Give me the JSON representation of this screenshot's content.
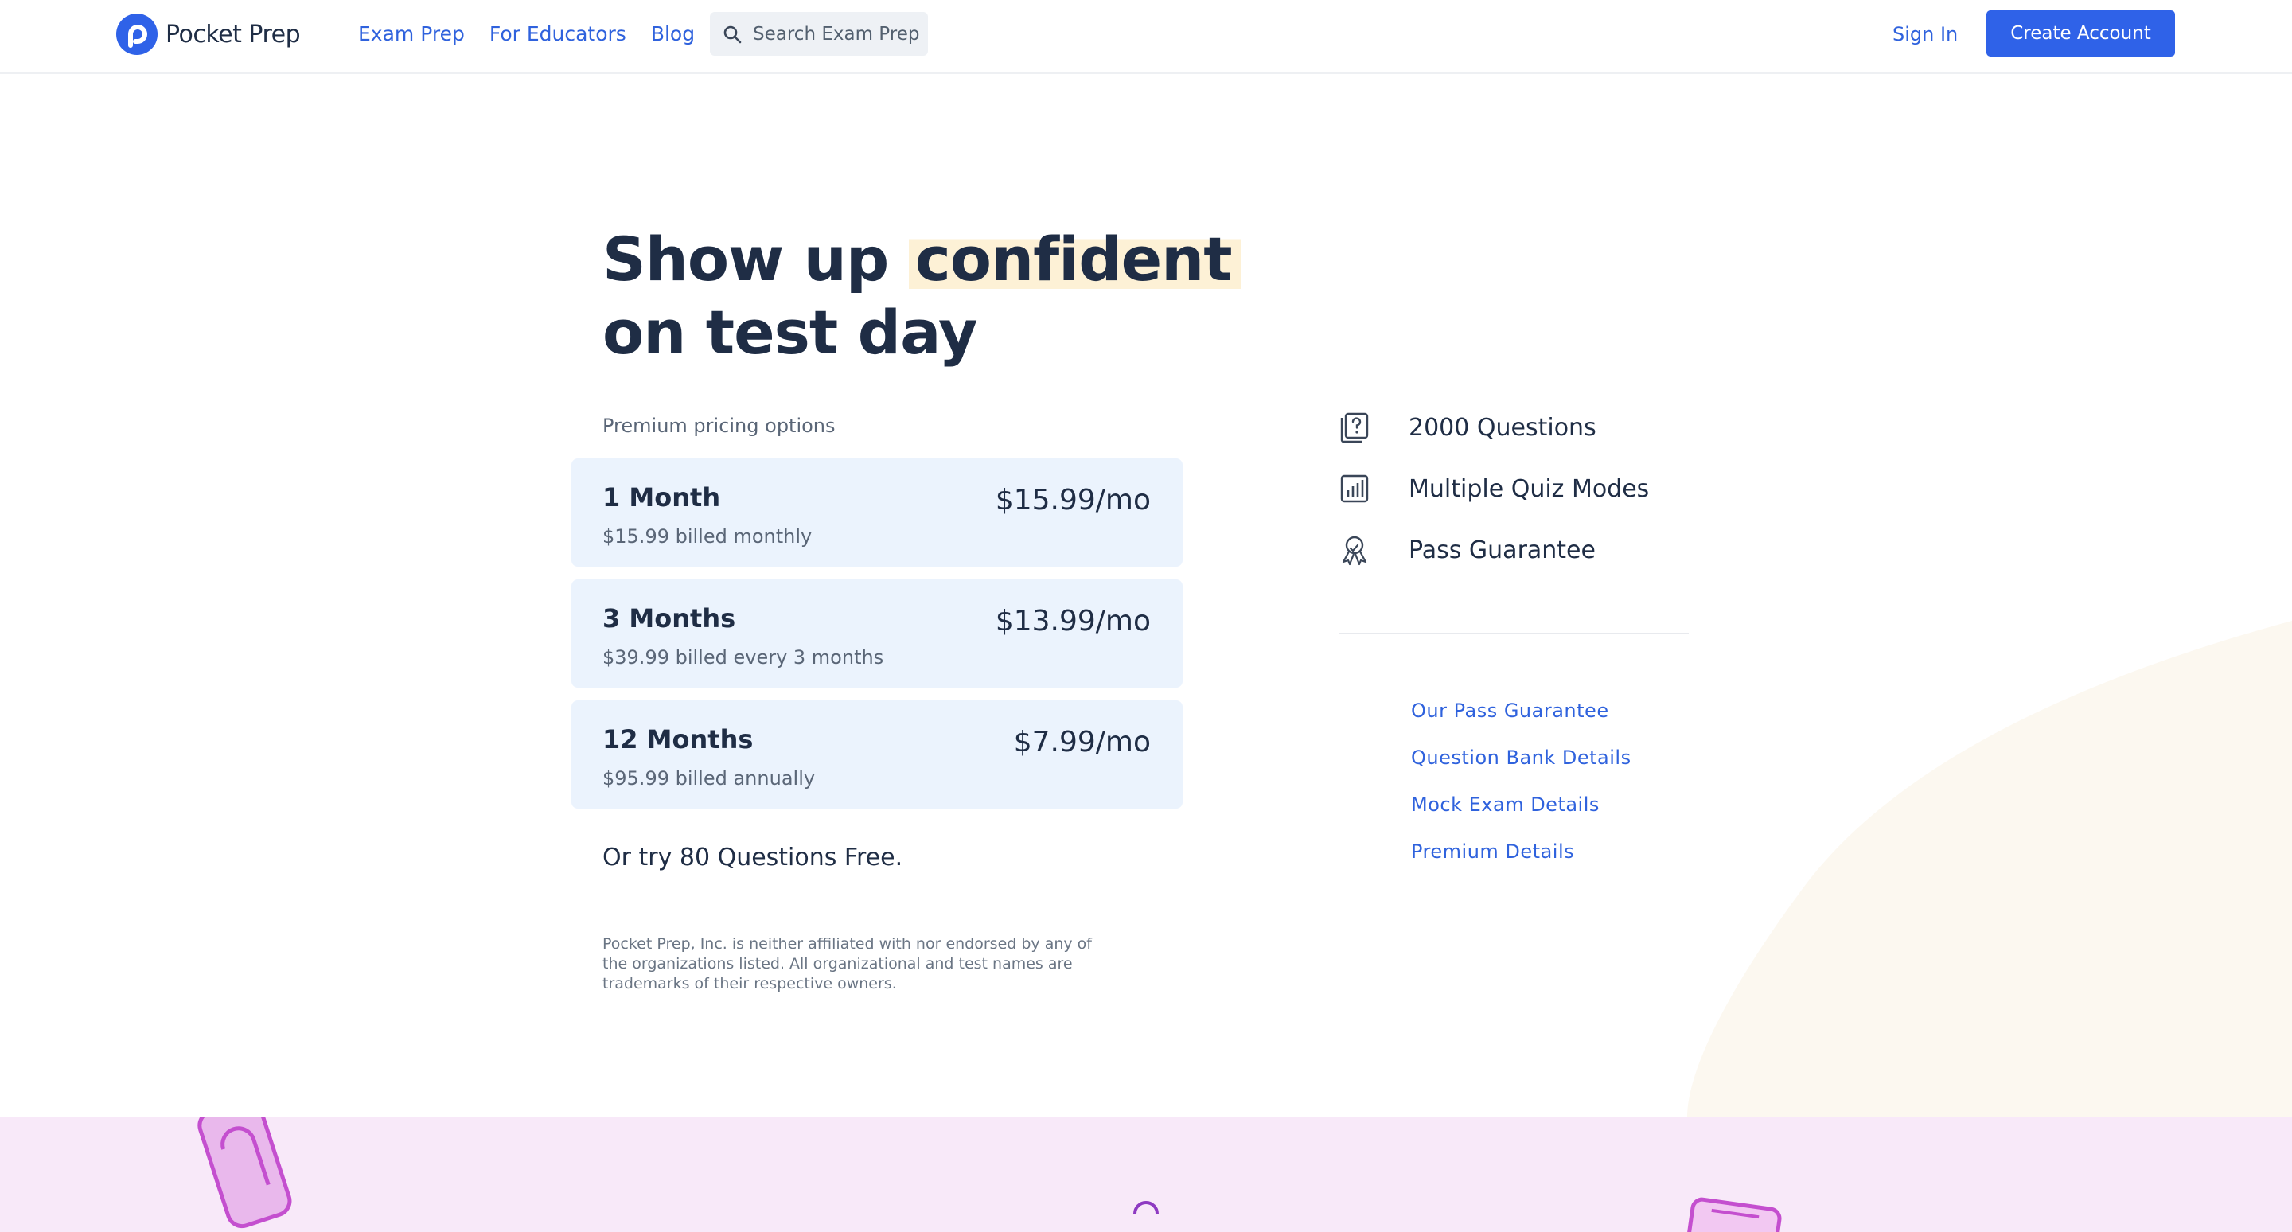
{
  "header": {
    "brand": "Pocket Prep",
    "nav": [
      "Exam Prep",
      "For Educators",
      "Blog"
    ],
    "search_placeholder": "Search Exam Prep",
    "sign_in": "Sign In",
    "create_account": "Create Account"
  },
  "hero": {
    "title_start": "Show up",
    "title_highlight": "confident",
    "title_end": "on test day"
  },
  "pricing": {
    "label": "Premium pricing options",
    "plans": [
      {
        "name": "1 Month",
        "billed": "$15.99 billed monthly",
        "price": "$15.99/mo"
      },
      {
        "name": "3 Months",
        "billed": "$39.99 billed every 3 months",
        "price": "$13.99/mo"
      },
      {
        "name": "12 Months",
        "billed": "$95.99 billed annually",
        "price": "$7.99/mo"
      }
    ],
    "free_trial": "Or try 80 Questions Free.",
    "disclaimer": "Pocket Prep, Inc. is neither affiliated with nor endorsed by any of the organizations listed. All organizational and test names are trademarks of their respective owners."
  },
  "features": [
    "2000 Questions",
    "Multiple Quiz Modes",
    "Pass Guarantee"
  ],
  "links": [
    "Our Pass Guarantee",
    "Question Bank Details",
    "Mock Exam Details",
    "Premium Details"
  ],
  "colors": {
    "accent": "#2f62e8",
    "plan_bg": "#ebf3fd",
    "highlight": "#fdf1d6",
    "band": "#f8e9f9"
  }
}
